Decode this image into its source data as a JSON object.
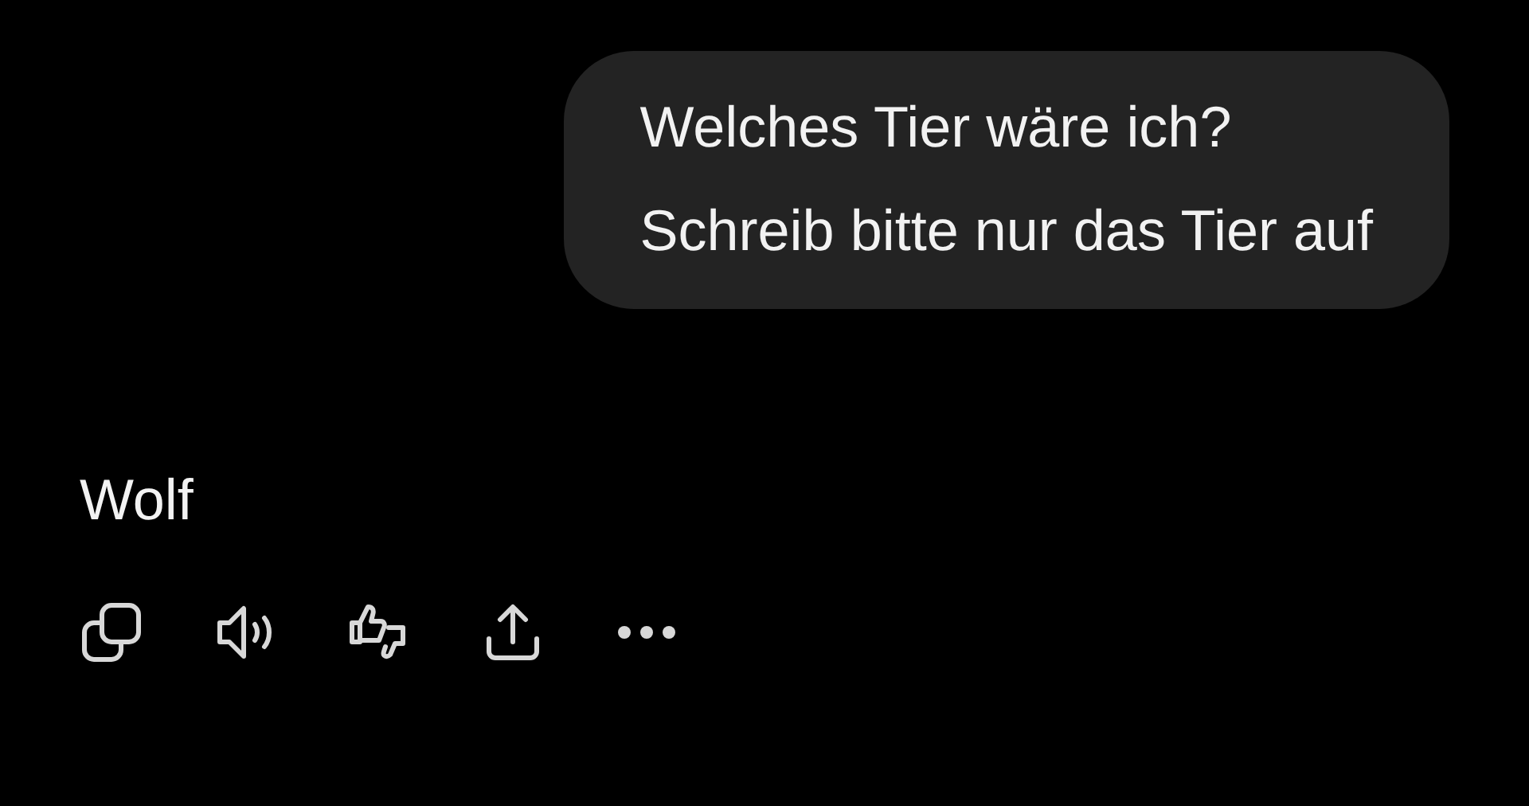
{
  "user_message": {
    "lines": [
      "Welches Tier wäre ich?",
      "Schreib bitte nur das Tier auf"
    ]
  },
  "assistant_message": {
    "text": "Wolf"
  },
  "actions": [
    {
      "kind": "copy"
    },
    {
      "kind": "speak"
    },
    {
      "kind": "rate"
    },
    {
      "kind": "share"
    },
    {
      "kind": "more"
    }
  ]
}
